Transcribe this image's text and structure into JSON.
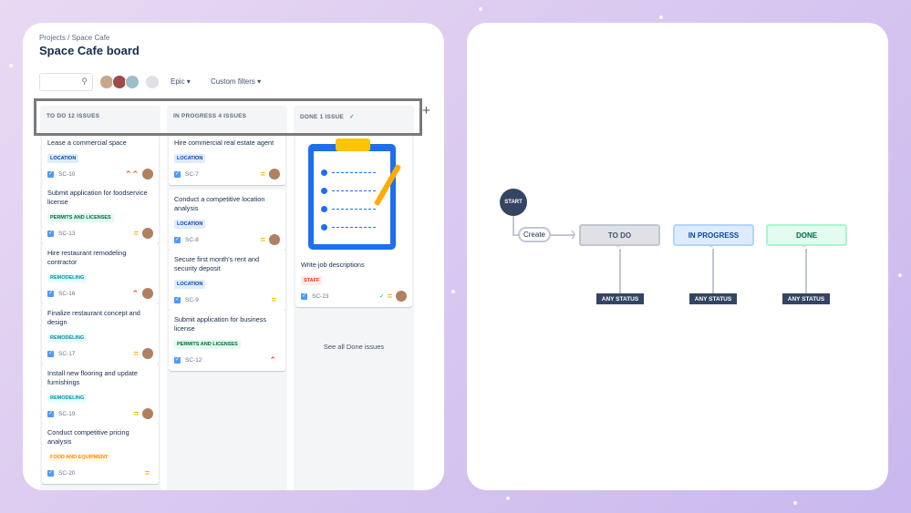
{
  "board": {
    "breadcrumb": "Projects / Space Cafe",
    "title": "Space Cafe board",
    "search_placeholder": "",
    "filters": {
      "epic": "Epic",
      "custom": "Custom filters"
    },
    "add_column": "+",
    "columns": [
      {
        "header": "TO DO 12 ISSUES",
        "cards": [
          {
            "title": "Lease a commercial space",
            "label": "LOCATION",
            "key": "SC-10",
            "priority": "highest"
          },
          {
            "title": "Submit application for foodservice license",
            "label": "PERMITS AND LICENSES",
            "key": "SC-13",
            "priority": "medium"
          },
          {
            "title": "Hire restaurant remodeling contractor",
            "label": "REMODELING",
            "key": "SC-16",
            "priority": "high"
          },
          {
            "title": "Finalize restaurant concept and design",
            "label": "REMODELING",
            "key": "SC-17",
            "priority": "medium"
          },
          {
            "title": "Install new flooring and update furnishings",
            "label": "REMODELING",
            "key": "SC-19",
            "priority": "medium"
          },
          {
            "title": "Conduct competitive pricing analysis",
            "label": "FOOD AND EQUIPMENT",
            "key": "SC-20",
            "priority": "medium"
          }
        ]
      },
      {
        "header": "IN PROGRESS 4 ISSUES",
        "cards": [
          {
            "title": "Hire commercial real estate agent",
            "label": "LOCATION",
            "key": "SC-7",
            "priority": "medium"
          },
          {
            "title": "Conduct a competitive location analysis",
            "label": "LOCATION",
            "key": "SC-8",
            "priority": "medium"
          },
          {
            "title": "Secure first month's rent and security deposit",
            "label": "LOCATION",
            "key": "SC-9",
            "priority": "medium"
          },
          {
            "title": "Submit application for business license",
            "label": "PERMITS AND LICENSES",
            "key": "SC-12",
            "priority": "high"
          }
        ]
      },
      {
        "header": "DONE 1 ISSUE",
        "cards": [
          {
            "title": "Write job descriptions",
            "label": "STAFF",
            "key": "SC-23",
            "priority": "medium"
          }
        ],
        "see_all": "See all Done issues"
      }
    ]
  },
  "workflow": {
    "start": "START",
    "create": "Create",
    "statuses": [
      "TO DO",
      "IN PROGRESS",
      "DONE"
    ],
    "any_status": "ANY STATUS"
  },
  "colors": {
    "location": "#0747a6",
    "permits": "#006644",
    "remodeling": "#008da6",
    "food": "#ff8b00",
    "staff": "#de350b",
    "start": "#344563"
  }
}
